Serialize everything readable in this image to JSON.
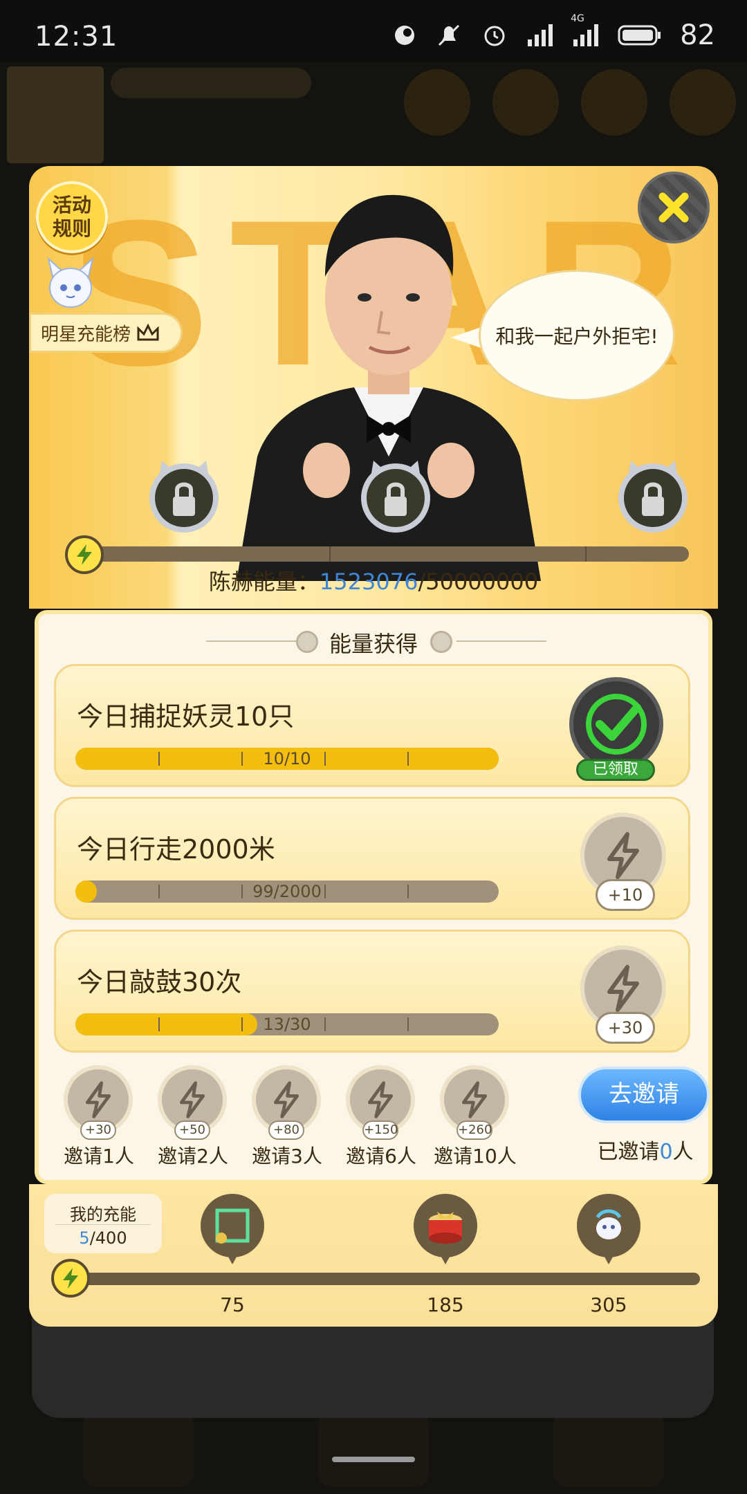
{
  "status_bar": {
    "time": "12:31",
    "battery": "82",
    "network": "4G"
  },
  "modal": {
    "rules_label": "活动\n规则",
    "rank_label": "明星充能榜",
    "speech": "和我一起户外拒宅!",
    "star_text": "STAR",
    "energy": {
      "label": "陈赫能量：",
      "current": "1523076",
      "total": "/50000000",
      "progress_fraction": 0.03
    },
    "tasks_title": "能量获得",
    "tasks": [
      {
        "title": "今日捕捉妖灵10只",
        "progress": "10/10",
        "fraction": 1.0,
        "status": "已领取"
      },
      {
        "title": "今日行走2000米",
        "progress": "99/2000",
        "fraction": 0.05,
        "reward": "+10"
      },
      {
        "title": "今日敲鼓30次",
        "progress": "13/30",
        "fraction": 0.43,
        "reward": "+30"
      }
    ],
    "invites": [
      {
        "label": "邀请1人",
        "bonus": "+30"
      },
      {
        "label": "邀请2人",
        "bonus": "+50"
      },
      {
        "label": "邀请3人",
        "bonus": "+80"
      },
      {
        "label": "邀请6人",
        "bonus": "+150"
      },
      {
        "label": "邀请10人",
        "bonus": "+260"
      }
    ],
    "invite_button": "去邀请",
    "invited": {
      "prefix": "已邀请",
      "count": "0",
      "suffix": "人"
    },
    "my_charge": {
      "label": "我的充能",
      "current": "5",
      "total": "/400",
      "progress_fraction": 0.0125
    },
    "milestones": [
      {
        "value": "75",
        "icon": "frame-icon"
      },
      {
        "value": "185",
        "icon": "gift-drum-icon"
      },
      {
        "value": "305",
        "icon": "pet-icon"
      }
    ]
  },
  "colors": {
    "accent_blue": "#3f86d6",
    "progress_yellow": "#f3b600",
    "claimed_green": "#3aa83a"
  }
}
